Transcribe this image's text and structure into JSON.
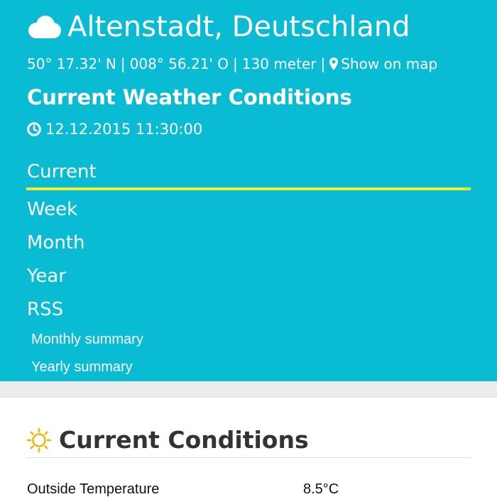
{
  "header": {
    "title": "Altenstadt, Deutschland",
    "latitude": "50° 17.32' N",
    "longitude": "008° 56.21' O",
    "altitude": "130 meter",
    "separator": "|",
    "map_link": "Show on map",
    "conditions_heading": "Current Weather Conditions",
    "datetime": "12.12.2015 11:30:00",
    "icons": [
      "cloud-icon",
      "map-marker-icon",
      "clock-icon"
    ]
  },
  "nav": {
    "items": [
      {
        "label": "Current",
        "active": true
      },
      {
        "label": "Week"
      },
      {
        "label": "Month"
      },
      {
        "label": "Year"
      },
      {
        "label": "RSS"
      }
    ],
    "sub_items": [
      {
        "label": "Monthly summary"
      },
      {
        "label": "Yearly summary"
      }
    ]
  },
  "current_conditions": {
    "title": "Current Conditions",
    "icon": "sun-icon",
    "rows": [
      {
        "label": "Outside Temperature",
        "value": "8.5°C"
      }
    ]
  },
  "colors": {
    "header_bg": "#0abcd3",
    "active_underline": "#f0f22a",
    "sun_icon": "#f2b705",
    "page_bg": "#ececec"
  }
}
